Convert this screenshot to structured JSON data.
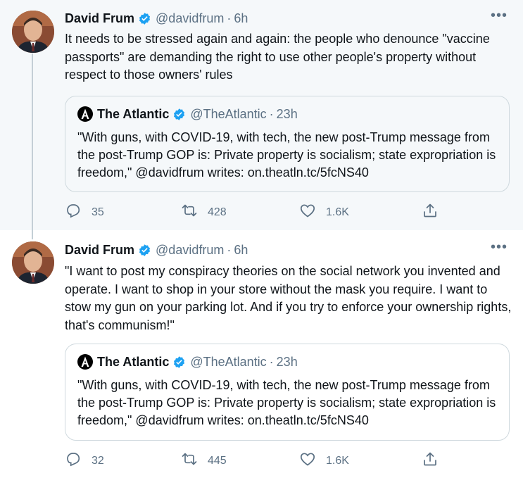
{
  "tweets": [
    {
      "author": {
        "name": "David Frum",
        "handle": "@davidfrum",
        "time": "6h"
      },
      "text": "It needs to be stressed again and again: the people who denounce \"vaccine passports\" are demanding the right to use other people's property without respect to those owners' rules",
      "quote": {
        "name": "The Atlantic",
        "handle": "@TheAtlantic",
        "time": "23h",
        "text": "\"With guns, with COVID-19, with tech, the new post-Trump message from the post-Trump GOP is: Private property is socialism; state expropriation is freedom,\" @davidfrum writes: on.theatln.tc/5fcNS40"
      },
      "stats": {
        "replies": "35",
        "retweets": "428",
        "likes": "1.6K"
      }
    },
    {
      "author": {
        "name": "David Frum",
        "handle": "@davidfrum",
        "time": "6h"
      },
      "text": "\"I want to post my conspiracy theories on the social network you invented and operate. I want to shop in your store without the mask you require. I want to stow my gun on your parking lot. And if you try to enforce your ownership rights, that's communism!\"",
      "quote": {
        "name": "The Atlantic",
        "handle": "@TheAtlantic",
        "time": "23h",
        "text": "\"With guns, with COVID-19, with tech, the new post-Trump message from the post-Trump GOP is: Private property is socialism; state expropriation is freedom,\" @davidfrum writes: on.theatln.tc/5fcNS40"
      },
      "stats": {
        "replies": "32",
        "retweets": "445",
        "likes": "1.6K"
      }
    }
  ],
  "separator": "·",
  "more_glyph": "•••",
  "icons": {
    "verified": "verified-badge-icon",
    "reply": "reply-icon",
    "retweet": "retweet-icon",
    "like": "heart-icon",
    "share": "share-icon",
    "more": "more-options-icon",
    "atlantic_logo": "atlantic-logo-icon"
  },
  "colors": {
    "verified_blue": "#1da1f2",
    "muted_text": "#5b7083",
    "thread_line": "#c4cfd6",
    "highlight_bg": "#f5f8fa"
  }
}
